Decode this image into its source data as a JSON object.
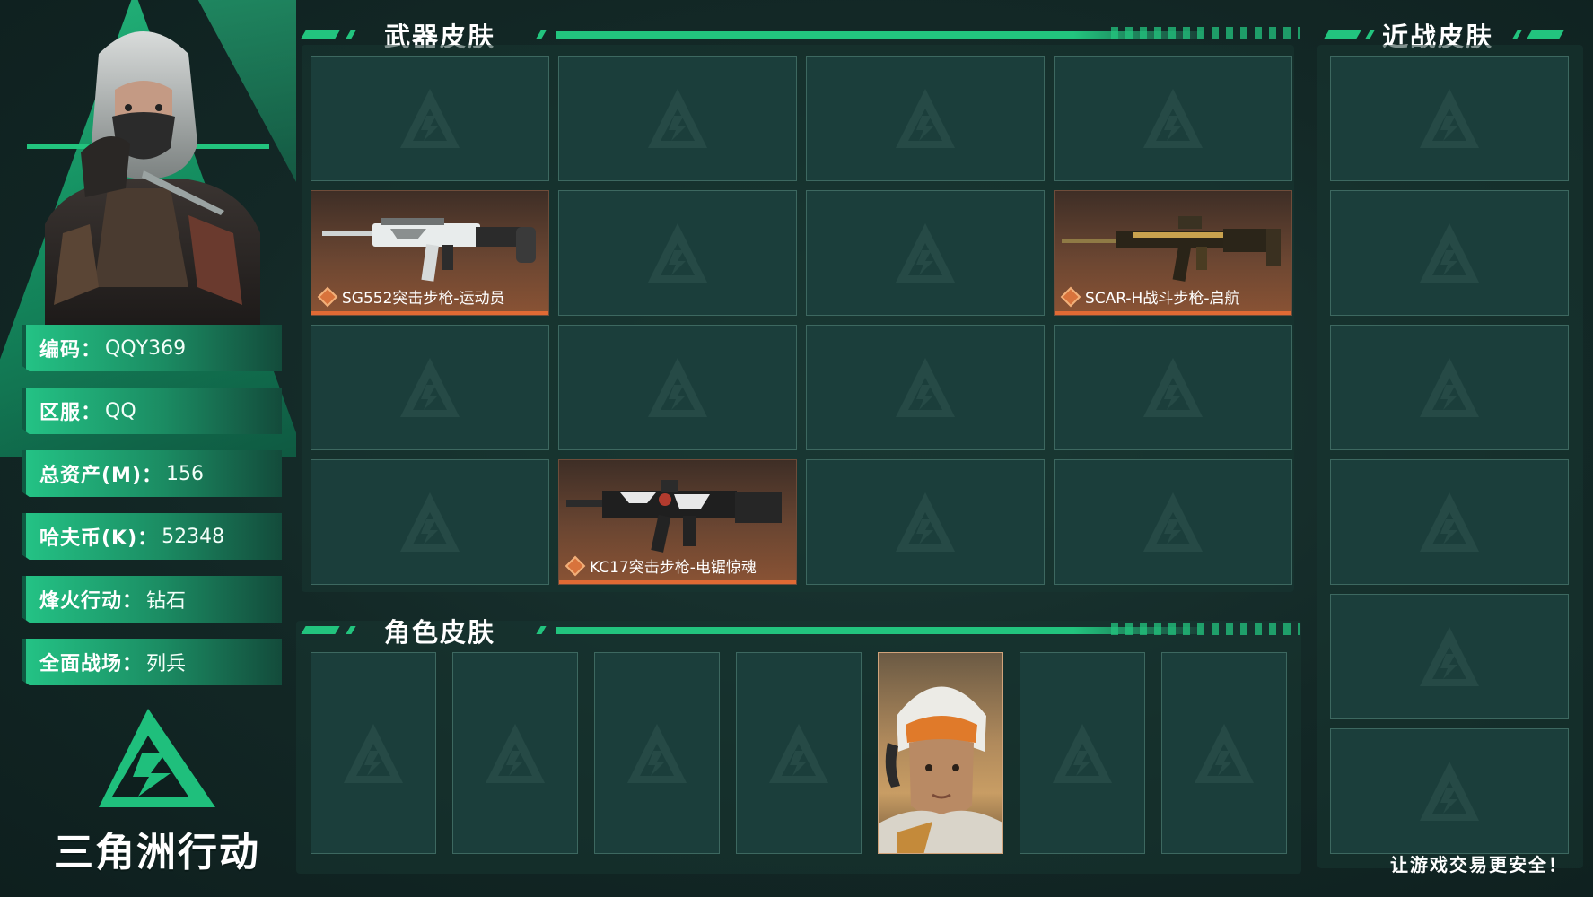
{
  "profile": {
    "fields": [
      {
        "label": "编码：",
        "value": "QQY369"
      },
      {
        "label": "区服：",
        "value": "QQ"
      },
      {
        "label": "总资产(M)：",
        "value": "156"
      },
      {
        "label": "哈夫币(K)：",
        "value": "52348"
      },
      {
        "label": "烽火行动：",
        "value": "钻石"
      },
      {
        "label": "全面战场：",
        "value": "列兵"
      }
    ]
  },
  "brand": {
    "name": "三角洲行动"
  },
  "sections": {
    "weapon": {
      "title": "武器皮肤"
    },
    "melee": {
      "title": "近战皮肤"
    },
    "role": {
      "title": "角色皮肤"
    }
  },
  "weapon_skins": {
    "sg552": {
      "name": "SG552突击步枪-运动员",
      "icon": "rarity-diamond-icon"
    },
    "scarh": {
      "name": "SCAR-H战斗步枪-启航",
      "icon": "rarity-diamond-icon"
    },
    "kc17": {
      "name": "KC17突击步枪-电锯惊魂",
      "icon": "rarity-diamond-icon"
    }
  },
  "tagline": "让游戏交易更安全！",
  "colors": {
    "accent": "#22c47e",
    "panel_bg": "#1b3e3b",
    "rarity": "#e06a34"
  }
}
